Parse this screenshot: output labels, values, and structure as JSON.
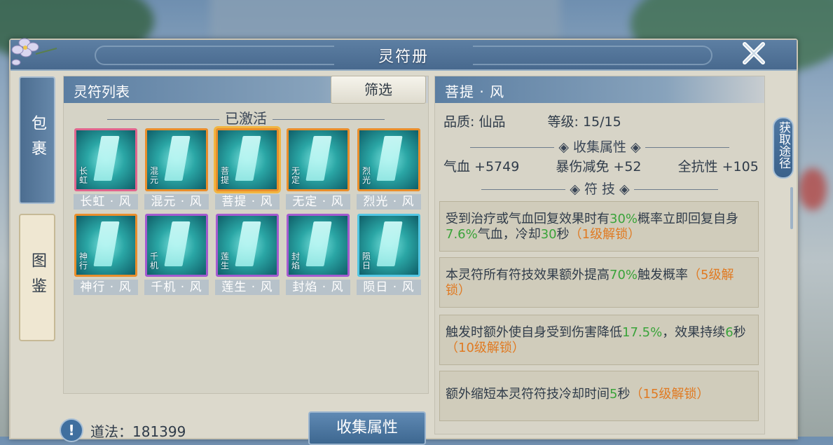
{
  "window": {
    "title": "灵符册"
  },
  "tabs": [
    {
      "label": "包裹",
      "active": true
    },
    {
      "label": "图鉴",
      "active": false
    }
  ],
  "list": {
    "header": "灵符列表",
    "filter_label": "筛选",
    "section_label": "已激活",
    "items": [
      {
        "name": "长虹 · 风",
        "glyph": "长虹",
        "border": "red"
      },
      {
        "name": "混元 · 风",
        "glyph": "混元",
        "border": "orange"
      },
      {
        "name": "菩提 · 风",
        "glyph": "菩提",
        "border": "orange",
        "selected": true
      },
      {
        "name": "无定 · 风",
        "glyph": "无定",
        "border": "orange"
      },
      {
        "name": "烈光 · 风",
        "glyph": "烈光",
        "border": "orange"
      },
      {
        "name": "神行 · 风",
        "glyph": "神行",
        "border": "orange"
      },
      {
        "name": "千机 · 风",
        "glyph": "千机",
        "border": "purple"
      },
      {
        "name": "莲生 · 风",
        "glyph": "莲生",
        "border": "purple"
      },
      {
        "name": "封焰 · 风",
        "glyph": "封焰",
        "border": "purple"
      },
      {
        "name": "陨日 · 风",
        "glyph": "陨日",
        "border": "blue"
      }
    ]
  },
  "bottom": {
    "dao_label": "道法：181399",
    "collect_button": "收集属性"
  },
  "detail": {
    "title": "菩提 · 风",
    "quality": "品质: 仙品",
    "level": "等级: 15/15",
    "collect_header": "收集属性",
    "stats": [
      "气血 +5749",
      "暴伤减免 +52",
      "全抗性 +105"
    ],
    "skill_header": "符 技",
    "skills": [
      [
        {
          "t": "受到治疗或气血回复效果时有"
        },
        {
          "t": "30%",
          "c": "g"
        },
        {
          "t": "概率立即回复自身"
        },
        {
          "t": "7.6%",
          "c": "g"
        },
        {
          "t": "气血，冷却"
        },
        {
          "t": "30",
          "c": "g"
        },
        {
          "t": "秒"
        },
        {
          "t": "（1级解锁）",
          "c": "o"
        }
      ],
      [
        {
          "t": "本灵符所有符技效果额外提高"
        },
        {
          "t": "70%",
          "c": "g"
        },
        {
          "t": "触发概率"
        },
        {
          "t": "（5级解锁）",
          "c": "o"
        }
      ],
      [
        {
          "t": "触发时额外使自身受到伤害降低"
        },
        {
          "t": "17.5%",
          "c": "g"
        },
        {
          "t": "，效果持续"
        },
        {
          "t": "6",
          "c": "g"
        },
        {
          "t": "秒"
        },
        {
          "t": "（10级解锁）",
          "c": "o"
        }
      ],
      [
        {
          "t": "额外缩短本灵符符技冷却时间"
        },
        {
          "t": "5",
          "c": "g"
        },
        {
          "t": "秒"
        },
        {
          "t": "（15级解锁）",
          "c": "o"
        }
      ]
    ]
  },
  "side_button": "获取途径",
  "colors": {
    "accent": "#4c6d90",
    "green": "#3aa33a",
    "orange": "#e07a22"
  }
}
